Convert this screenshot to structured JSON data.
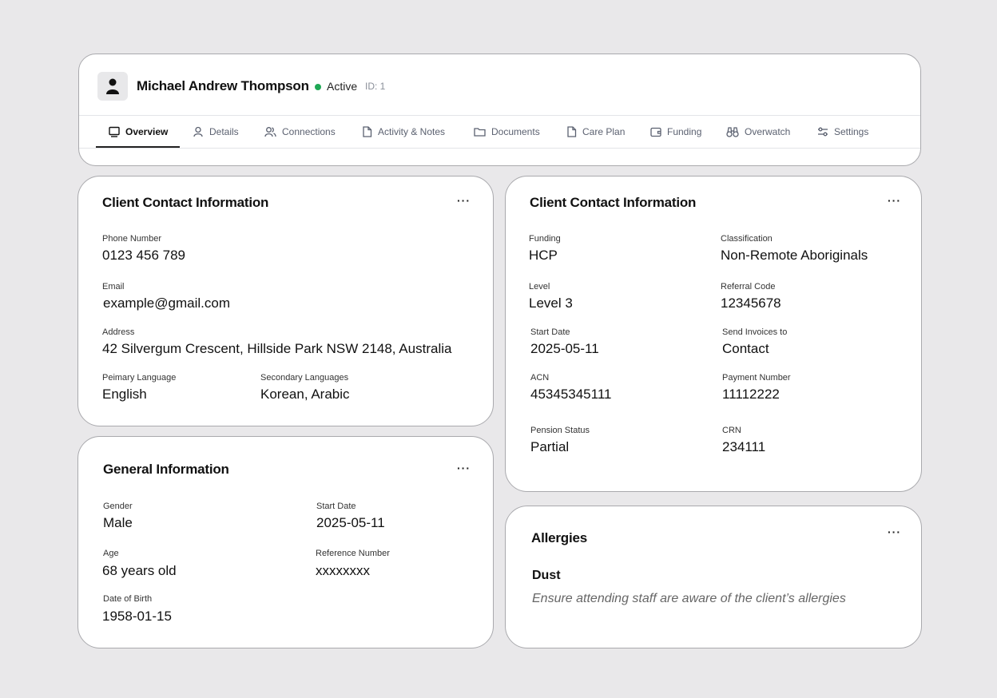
{
  "header": {
    "client_name": "Michael Andrew Thompson",
    "status": "Active",
    "status_color": "#1fa855",
    "client_id": "ID: 1"
  },
  "tabs": [
    {
      "label": "Overview",
      "icon": "monitor-icon",
      "active": true
    },
    {
      "label": "Details",
      "icon": "user-icon"
    },
    {
      "label": "Connections",
      "icon": "users-icon"
    },
    {
      "label": "Activity & Notes",
      "icon": "file-icon"
    },
    {
      "label": "Documents",
      "icon": "folder-icon"
    },
    {
      "label": "Care Plan",
      "icon": "file-icon"
    },
    {
      "label": "Funding",
      "icon": "wallet-icon"
    },
    {
      "label": "Overwatch",
      "icon": "binoculars-icon"
    },
    {
      "label": "Settings",
      "icon": "sliders-icon"
    }
  ],
  "contact": {
    "title": "Client Contact Information",
    "more": "···",
    "phone_label": "Phone Number",
    "phone": "0123 456 789",
    "email_label": "Email",
    "email": "example@gmail.com",
    "address_label": "Address",
    "address": "42 Silvergum Crescent, Hillside Park NSW 2148, Australia",
    "primary_lang_label": "Peimary Language",
    "primary_lang": "English",
    "secondary_lang_label": "Secondary Languages",
    "secondary_lang": "Korean, Arabic"
  },
  "general": {
    "title": "General Information",
    "more": "···",
    "gender_label": "Gender",
    "gender": "Male",
    "start_label": "Start Date",
    "start": "2025-05-11",
    "age_label": "Age",
    "age": "68 years old",
    "ref_label": "Reference Number",
    "ref": "xxxxxxxx",
    "dob_label": "Date of Birth",
    "dob": "1958-01-15"
  },
  "funding": {
    "title": "Client Contact Information",
    "more": "···",
    "funding_label": "Funding",
    "funding": "HCP",
    "classification_label": "Classification",
    "classification": "Non-Remote Aboriginals",
    "level_label": "Level",
    "level": "Level 3",
    "referral_label": "Referral Code",
    "referral": "12345678",
    "start_label": "Start Date",
    "start": "2025-05-11",
    "invoices_label": "Send Invoices to",
    "invoices": "Contact",
    "acn_label": "ACN",
    "acn": "45345345111",
    "payment_label": "Payment Number",
    "payment": "11112222",
    "pension_label": "Pension Status",
    "pension": "Partial",
    "crn_label": "CRN",
    "crn": "234111"
  },
  "allergies": {
    "title": "Allergies",
    "more": "···",
    "item": "Dust",
    "note": "Ensure attending staff are aware of the client’s allergies"
  }
}
